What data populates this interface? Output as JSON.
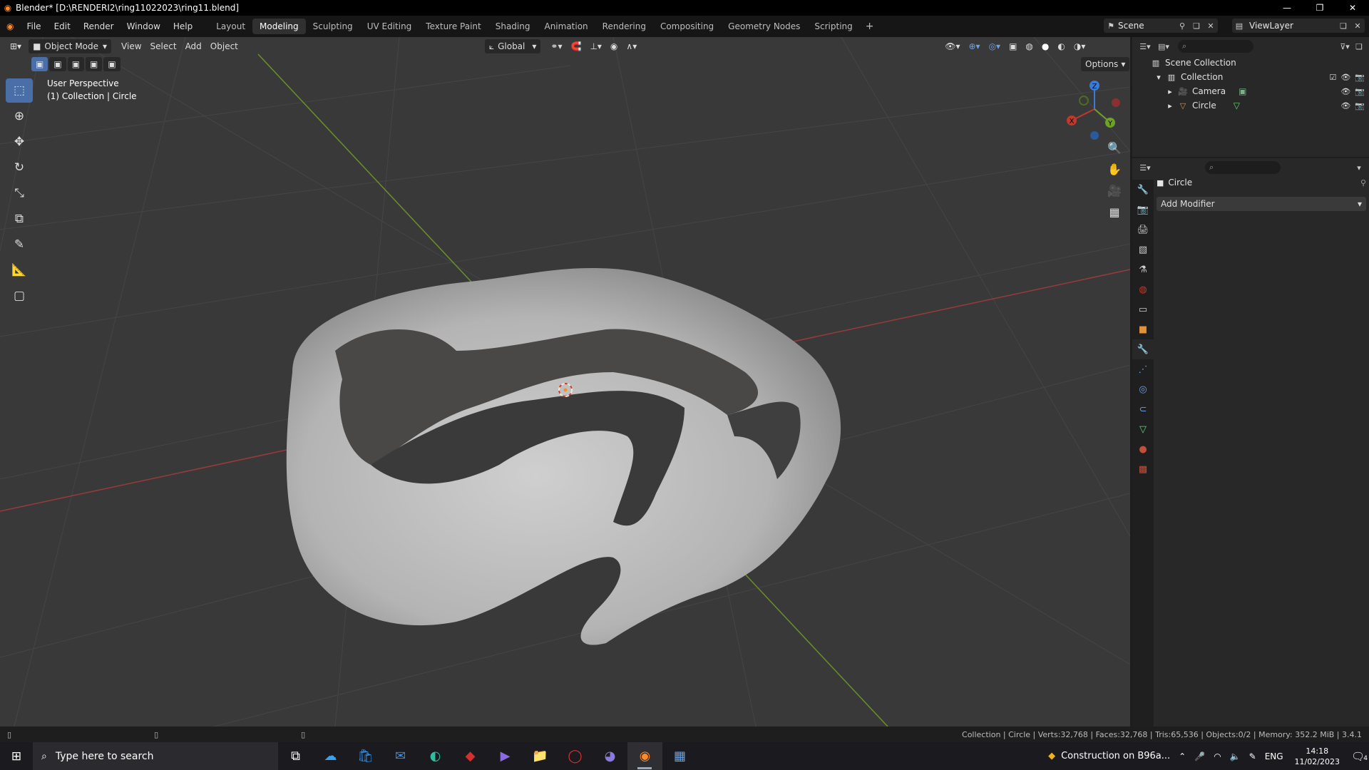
{
  "window": {
    "title": "Blender* [D:\\RENDERI2\\ring11022023\\ring11.blend]"
  },
  "menu": [
    "File",
    "Edit",
    "Render",
    "Window",
    "Help"
  ],
  "workspaces": [
    "Layout",
    "Modeling",
    "Sculpting",
    "UV Editing",
    "Texture Paint",
    "Shading",
    "Animation",
    "Rendering",
    "Compositing",
    "Geometry Nodes",
    "Scripting"
  ],
  "active_workspace": "Modeling",
  "scene": {
    "label": "Scene"
  },
  "view_layer": {
    "label": "ViewLayer"
  },
  "viewport": {
    "mode": "Object Mode",
    "menus": [
      "View",
      "Select",
      "Add",
      "Object"
    ],
    "orientation": "Global",
    "options_label": "Options",
    "info_line1": "User Perspective",
    "info_line2": "(1) Collection | Circle",
    "gizmo_axes": [
      "Z",
      "X",
      "Y"
    ]
  },
  "outliner": {
    "root": "Scene Collection",
    "collection": "Collection",
    "items": [
      "Camera",
      "Circle"
    ]
  },
  "properties": {
    "object_name": "Circle",
    "add_modifier_label": "Add Modifier"
  },
  "statusbar": {
    "stats": "Collection | Circle | Verts:32,768 | Faces:32,768 | Tris:65,536 | Objects:0/2 | Memory: 352.2 MiB | 3.4.1"
  },
  "taskbar": {
    "search_placeholder": "Type here to search",
    "notification": "Construction on B96a...",
    "language": "ENG",
    "time": "14:18",
    "date": "11/02/2023",
    "notif_count": "4"
  },
  "colors": {
    "accent": "#4a6fa8",
    "x_axis": "#c0392b",
    "y_axis": "#6fa02a",
    "z_axis": "#3a7bd5",
    "active_obj": "#ff8a2a"
  }
}
